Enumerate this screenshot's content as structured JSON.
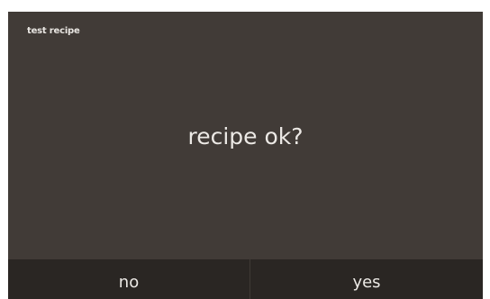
{
  "screen": {
    "title": "test recipe",
    "prompt": "recipe ok?"
  },
  "buttons": {
    "no_label": "no",
    "yes_label": "yes"
  },
  "colors": {
    "panel_background": "#413b37",
    "button_bar_background": "#2a2623",
    "text": "#ece9e5",
    "page_background": "#ffffff"
  }
}
